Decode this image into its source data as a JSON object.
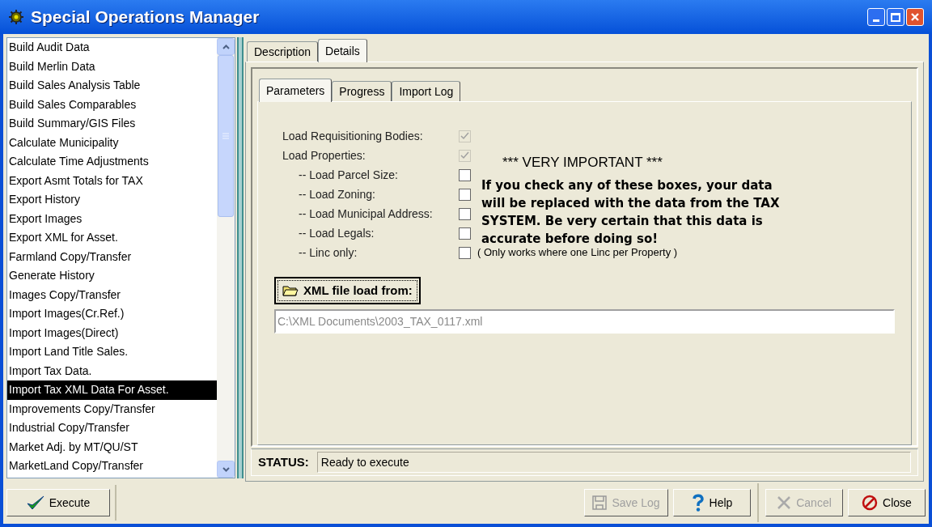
{
  "window": {
    "title": "Special Operations Manager"
  },
  "operations": [
    {
      "label": "Build Audit Data",
      "selected": false
    },
    {
      "label": "Build Merlin Data",
      "selected": false
    },
    {
      "label": "Build Sales Analysis Table",
      "selected": false
    },
    {
      "label": "Build Sales Comparables",
      "selected": false
    },
    {
      "label": "Build Summary/GIS Files",
      "selected": false
    },
    {
      "label": "Calculate Municipality",
      "selected": false
    },
    {
      "label": "Calculate Time Adjustments",
      "selected": false
    },
    {
      "label": "Export Asmt Totals for TAX",
      "selected": false
    },
    {
      "label": "Export History",
      "selected": false
    },
    {
      "label": "Export Images",
      "selected": false
    },
    {
      "label": "Export XML for Asset.",
      "selected": false
    },
    {
      "label": "Farmland Copy/Transfer",
      "selected": false
    },
    {
      "label": "Generate History",
      "selected": false
    },
    {
      "label": "Images Copy/Transfer",
      "selected": false
    },
    {
      "label": "Import Images(Cr.Ref.)",
      "selected": false
    },
    {
      "label": "Import Images(Direct)",
      "selected": false
    },
    {
      "label": "Import Land Title Sales.",
      "selected": false
    },
    {
      "label": "Import Tax Data.",
      "selected": false
    },
    {
      "label": "Import Tax XML Data For Asset.",
      "selected": true
    },
    {
      "label": "Improvements Copy/Transfer",
      "selected": false
    },
    {
      "label": "Industrial Copy/Transfer",
      "selected": false
    },
    {
      "label": "Market Adj. by MT/QU/ST",
      "selected": false
    },
    {
      "label": "MarketLand Copy/Transfer",
      "selected": false
    }
  ],
  "tabs": [
    {
      "label": "Description",
      "selected": false
    },
    {
      "label": "Details",
      "selected": true
    }
  ],
  "sub_tabs": [
    {
      "label": "Parameters",
      "selected": true
    },
    {
      "label": "Progress",
      "selected": false
    },
    {
      "label": "Import Log",
      "selected": false
    }
  ],
  "options": [
    {
      "label": "Load Requisitioning Bodies:",
      "checked": true,
      "disabled": true
    },
    {
      "label": "Load Properties:",
      "checked": true,
      "disabled": true
    },
    {
      "label": "-- Load Parcel Size:",
      "checked": false,
      "disabled": false
    },
    {
      "label": "-- Load Zoning:",
      "checked": false,
      "disabled": false
    },
    {
      "label": "-- Load Municipal Address:",
      "checked": false,
      "disabled": false
    },
    {
      "label": "-- Load Legals:",
      "checked": false,
      "disabled": false
    },
    {
      "label": "-- Linc only:",
      "checked": false,
      "disabled": false,
      "note": "( Only works where one Linc per Property )"
    }
  ],
  "warning": {
    "heading": "*** VERY IMPORTANT ***",
    "text": "If you check any of these boxes, your data will be replaced with the data from the TAX SYSTEM. Be very certain that this data is accurate before doing so!"
  },
  "file_button": {
    "label": "XML file load from:"
  },
  "file_path": {
    "value": "C:\\XML Documents\\2003_TAX_0117.xml"
  },
  "status": {
    "label": "STATUS:",
    "value": "Ready to execute"
  },
  "buttons": [
    {
      "kind": "execute",
      "label": "Execute",
      "disabled": false
    },
    {
      "kind": "save",
      "label": "Save Log",
      "disabled": true
    },
    {
      "kind": "help",
      "label": "Help",
      "disabled": false
    },
    {
      "kind": "cancel",
      "label": "Cancel",
      "disabled": true
    },
    {
      "kind": "close",
      "label": "Close",
      "disabled": false
    }
  ]
}
